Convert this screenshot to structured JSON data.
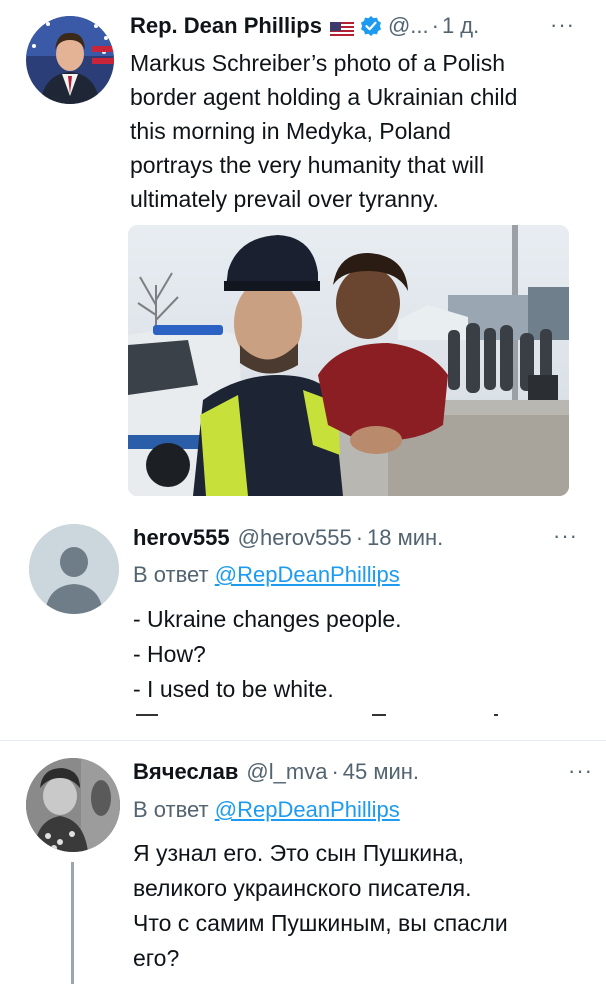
{
  "tweets": [
    {
      "name": "Rep. Dean Phillips",
      "flag": "🇺🇸",
      "handle": "@...",
      "sep": "·",
      "time": "1 д.",
      "more": "···",
      "text": "Markus Schreiber’s photo of a Polish\nborder agent holding a Ukrainian child\nthis morning in Medyka, Poland\nportrays the very humanity that will\nultimately prevail over tyranny.",
      "verified_icon": "verified-badge-icon",
      "accent": "#1d9bf0"
    },
    {
      "name": "herov555",
      "handle": "@herov555",
      "sep": "·",
      "time": "18 мин.",
      "more": "···",
      "reply_prefix": "В ответ",
      "reply_to": "@RepDeanPhillips",
      "lines": [
        "- Ukraine changes people.",
        "- How?",
        "- I used to be white."
      ]
    },
    {
      "name": "Вячеслав",
      "handle": "@l_mva",
      "sep": "·",
      "time": "45 мин.",
      "more": "···",
      "reply_prefix": "В ответ",
      "reply_to": "@RepDeanPhillips",
      "text": "Я узнал его. Это сын Пушкина,\nвеликого украинского писателя.\nЧто с самим Пушкиным, вы спасли\nего?"
    }
  ],
  "colors": {
    "text": "#0f1419",
    "muted": "#536471",
    "link": "#1d9bf0",
    "divider": "#e6ecf0"
  }
}
